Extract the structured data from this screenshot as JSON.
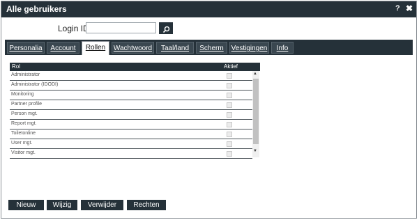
{
  "window": {
    "title": "Alle gebruikers",
    "help": "?",
    "close": "✖"
  },
  "login": {
    "label": "Login ID:",
    "value": "",
    "placeholder": ""
  },
  "tabs": [
    {
      "label": "Personalia"
    },
    {
      "label": "Account"
    },
    {
      "label": "Rollen"
    },
    {
      "label": "Wachtwoord"
    },
    {
      "label": "Taal/land"
    },
    {
      "label": "Scherm"
    },
    {
      "label": "Vestigingen"
    },
    {
      "label": "Info"
    }
  ],
  "active_tab": "Rollen",
  "table": {
    "columns": [
      "Rol",
      "Aktief"
    ],
    "rows": [
      {
        "rol": "Administrator",
        "aktief": false
      },
      {
        "rol": "Administrator (IDODI)",
        "aktief": false
      },
      {
        "rol": "Monitoring",
        "aktief": false
      },
      {
        "rol": "Partner profile",
        "aktief": false
      },
      {
        "rol": "Person mgt.",
        "aktief": false
      },
      {
        "rol": "Report mgt.",
        "aktief": false
      },
      {
        "rol": "Toiletonline",
        "aktief": false
      },
      {
        "rol": "User mgt.",
        "aktief": false
      },
      {
        "rol": "Visitor mgt.",
        "aktief": false
      }
    ]
  },
  "buttons": {
    "new": "Nieuw",
    "edit": "Wijzig",
    "delete": "Verwijder",
    "rights": "Rechten"
  },
  "colors": {
    "primary": "#253139",
    "tab_bg": "#3a4750",
    "white": "#ffffff"
  }
}
